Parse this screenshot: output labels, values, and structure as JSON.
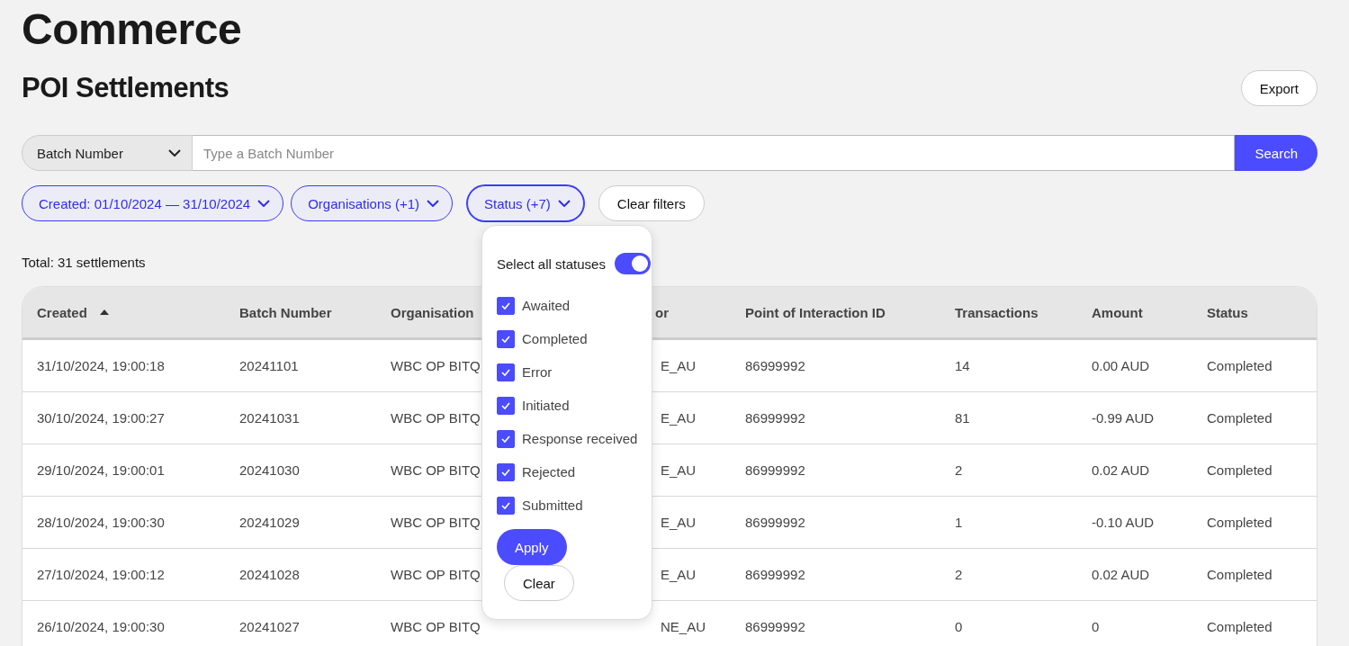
{
  "app_title": "Commerce",
  "page_title": "POI Settlements",
  "export_button": "Export",
  "search": {
    "field_select": "Batch Number",
    "placeholder": "Type a Batch Number",
    "button": "Search"
  },
  "filters": [
    {
      "label": "Created: 01/10/2024 — 31/10/2024",
      "expanded": false
    },
    {
      "label": "Organisations (+1)",
      "expanded": false
    },
    {
      "label": "Status (+7)",
      "expanded": true
    }
  ],
  "clear_filters": "Clear filters",
  "status_menu": {
    "select_all": {
      "label": "Select all statuses",
      "on": true
    },
    "options": [
      {
        "label": "Awaited",
        "checked": true
      },
      {
        "label": "Completed",
        "checked": true
      },
      {
        "label": "Error",
        "checked": true
      },
      {
        "label": "Initiated",
        "checked": true
      },
      {
        "label": "Response received",
        "checked": true
      },
      {
        "label": "Rejected",
        "checked": true
      },
      {
        "label": "Submitted",
        "checked": true
      }
    ],
    "apply": "Apply",
    "clear": "Clear"
  },
  "total": "Total: 31 settlements",
  "table": {
    "columns": [
      {
        "label": "Created",
        "sorted_ascending": true
      },
      {
        "label": "Batch Number"
      },
      {
        "label": "Organisation"
      },
      {
        "label": "or"
      },
      {
        "label": "Point of Interaction ID"
      },
      {
        "label": "Transactions"
      },
      {
        "label": "Amount"
      },
      {
        "label": "Status"
      }
    ],
    "rows": [
      [
        "31/10/2024, 19:00:18",
        "20241101",
        "WBC OP BITQ",
        "E_AU",
        "86999992",
        "14",
        "0.00 AUD",
        "Completed"
      ],
      [
        "30/10/2024, 19:00:27",
        "20241031",
        "WBC OP BITQ",
        "E_AU",
        "86999992",
        "81",
        "-0.99 AUD",
        "Completed"
      ],
      [
        "29/10/2024, 19:00:01",
        "20241030",
        "WBC OP BITQ",
        "E_AU",
        "86999992",
        "2",
        "0.02 AUD",
        "Completed"
      ],
      [
        "28/10/2024, 19:00:30",
        "20241029",
        "WBC OP BITQ",
        "E_AU",
        "86999992",
        "1",
        "-0.10 AUD",
        "Completed"
      ],
      [
        "27/10/2024, 19:00:12",
        "20241028",
        "WBC OP BITQ",
        "E_AU",
        "86999992",
        "2",
        "0.02 AUD",
        "Completed"
      ],
      [
        "26/10/2024, 19:00:30",
        "20241027",
        "WBC OP BITQ",
        "NE_AU",
        "86999992",
        "0",
        "0",
        "Completed"
      ]
    ]
  }
}
